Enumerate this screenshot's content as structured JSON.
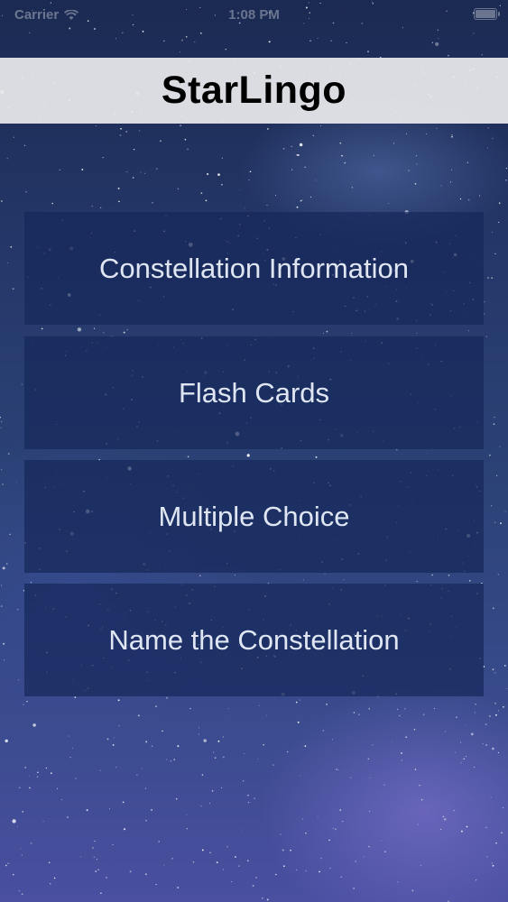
{
  "status_bar": {
    "carrier": "Carrier",
    "time": "1:08 PM",
    "wifi_icon": "wifi-icon",
    "battery_icon": "battery-icon"
  },
  "header": {
    "title": "StarLingo"
  },
  "menu": {
    "items": [
      {
        "label": "Constellation Information"
      },
      {
        "label": "Flash Cards"
      },
      {
        "label": "Multiple Choice"
      },
      {
        "label": "Name the Constellation"
      }
    ]
  },
  "colors": {
    "title_bar": "#ECECEE",
    "button_bg": "#16285A",
    "button_text": "#DFE6F2"
  }
}
